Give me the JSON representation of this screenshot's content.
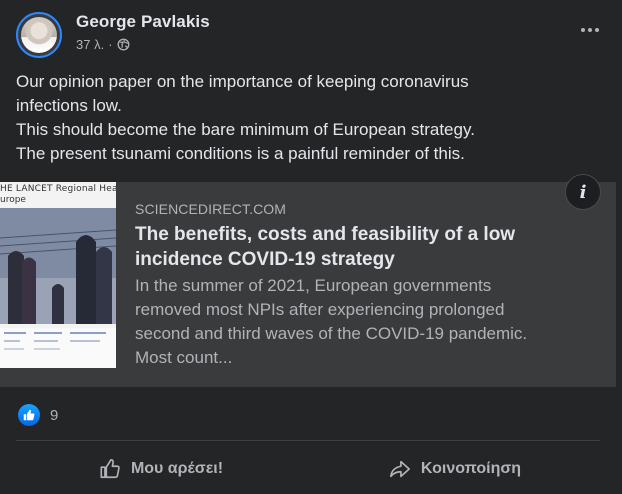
{
  "post": {
    "author": "George Pavlakis",
    "timestamp": "37 λ.",
    "separator": "·",
    "privacy_icon": "globe-icon",
    "more_icon": "more-options-icon",
    "text_lines": [
      "Our opinion paper on the importance of keeping coronavirus",
      "infections low.",
      "This should become the bare minimum of European strategy.",
      "The present tsunami conditions is a painful reminder of this."
    ]
  },
  "link_card": {
    "thumbnail_journal_line1": "HE LANCET Regional Health",
    "thumbnail_journal_line2": "urope",
    "domain": "SCIENCEDIRECT.COM",
    "title": "The benefits, costs and feasibility of a low incidence COVID-19 strategy",
    "description_lines": [
      "In the summer of 2021, European governments",
      "removed most NPIs after experiencing prolonged",
      "second and third waves of the COVID-19 pandemic.",
      "Most count..."
    ],
    "info_icon_glyph": "i"
  },
  "reactions": {
    "icon": "like-icon",
    "count": "9"
  },
  "actions": {
    "like_label": "Μου αρέσει!",
    "share_label": "Κοινοποίηση"
  },
  "colors": {
    "background": "#242526",
    "card": "#3a3b3c",
    "text_primary": "#e4e6eb",
    "text_secondary": "#b0b3b8",
    "like_blue": "#0566e8"
  }
}
